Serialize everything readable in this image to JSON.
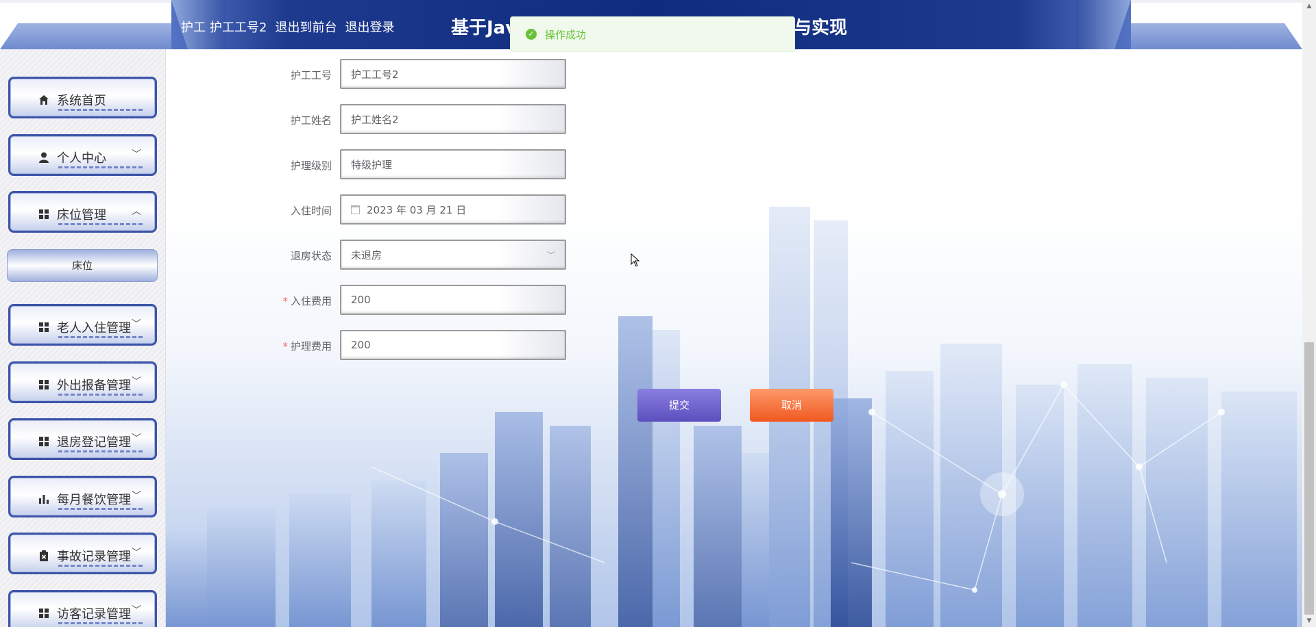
{
  "header": {
    "role": "护工",
    "username": "护工工号2",
    "to_front_label": "退出到前台",
    "logout_label": "退出登录",
    "title_start": "基于Jav",
    "title_end": "与实现"
  },
  "toast": {
    "message": "操作成功",
    "type": "success"
  },
  "sidebar": {
    "items": [
      {
        "label": "系统首页",
        "icon": "home-icon",
        "expanded": null
      },
      {
        "label": "个人中心",
        "icon": "user-icon",
        "expanded": false
      },
      {
        "label": "床位管理",
        "icon": "grid-icon",
        "expanded": true
      },
      {
        "label": "老人入住管理",
        "icon": "grid-icon",
        "expanded": false
      },
      {
        "label": "外出报备管理",
        "icon": "grid-icon",
        "expanded": false
      },
      {
        "label": "退房登记管理",
        "icon": "grid-icon",
        "expanded": false
      },
      {
        "label": "每月餐饮管理",
        "icon": "bar-chart-icon",
        "expanded": false
      },
      {
        "label": "事故记录管理",
        "icon": "clipboard-icon",
        "expanded": false
      },
      {
        "label": "访客记录管理",
        "icon": "grid-icon",
        "expanded": false
      }
    ],
    "subitem": {
      "label": "床位"
    }
  },
  "form": {
    "fields": [
      {
        "label": "护工工号",
        "value": "护工工号2",
        "required": false,
        "kind": "text"
      },
      {
        "label": "护工姓名",
        "value": "护工姓名2",
        "required": false,
        "kind": "text"
      },
      {
        "label": "护理级别",
        "value": "特级护理",
        "required": false,
        "kind": "text"
      },
      {
        "label": "入住时间",
        "value": "2023 年 03 月 21 日",
        "required": false,
        "kind": "date"
      },
      {
        "label": "退房状态",
        "value": "未退房",
        "required": false,
        "kind": "select"
      },
      {
        "label": "入住费用",
        "value": "200",
        "required": true,
        "kind": "text"
      },
      {
        "label": "护理费用",
        "value": "200",
        "required": true,
        "kind": "text"
      }
    ],
    "submit_label": "提交",
    "cancel_label": "取消"
  },
  "colors": {
    "header_navy": "#0f2b7d",
    "toast_green": "#67c23a",
    "submit_purple": "#5b4fbe",
    "cancel_orange": "#f0581f",
    "required_red": "#f56c6c"
  }
}
